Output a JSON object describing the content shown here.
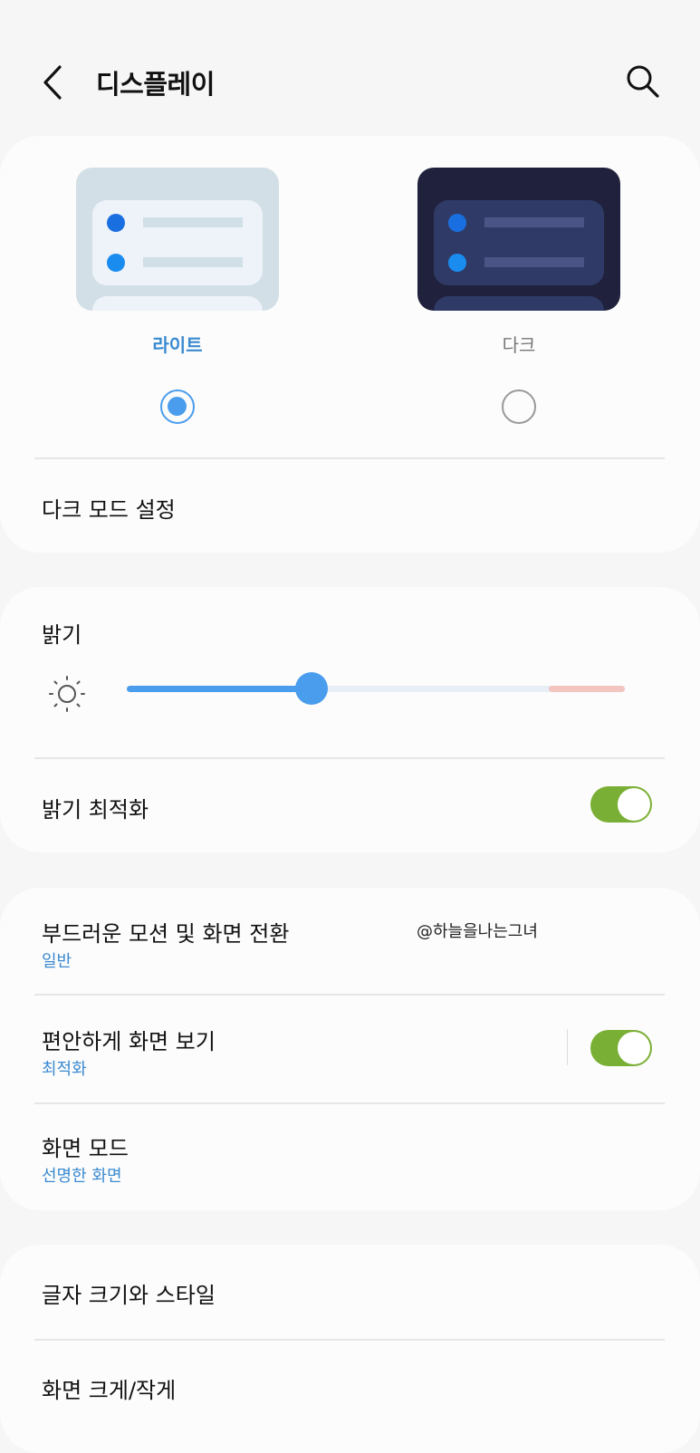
{
  "header": {
    "title": "디스플레이",
    "back_icon": "chevron-left-icon",
    "search_icon": "search-icon"
  },
  "theme": {
    "light_label": "라이트",
    "dark_label": "다크",
    "selected": "light",
    "dark_mode_settings": "다크 모드 설정"
  },
  "brightness": {
    "label": "밝기",
    "icon": "sun-icon",
    "level": 0.37,
    "adaptive_label": "밝기 최적화",
    "adaptive_on": true
  },
  "motion": {
    "smooth_label": "부드러운 모션 및 화면 전환",
    "smooth_value": "일반",
    "watermark": "@하늘을나는그녀",
    "eye_comfort_label": "편안하게 화면 보기",
    "eye_comfort_value": "최적화",
    "eye_comfort_on": true,
    "screen_mode_label": "화면 모드",
    "screen_mode_value": "선명한 화면"
  },
  "text": {
    "font_size_label": "글자 크기와 스타일",
    "zoom_label": "화면 크게/작게"
  },
  "colors": {
    "accent": "#3a8ad0",
    "toggle_on": "#7aaf35",
    "slider": "#4a9ded"
  }
}
